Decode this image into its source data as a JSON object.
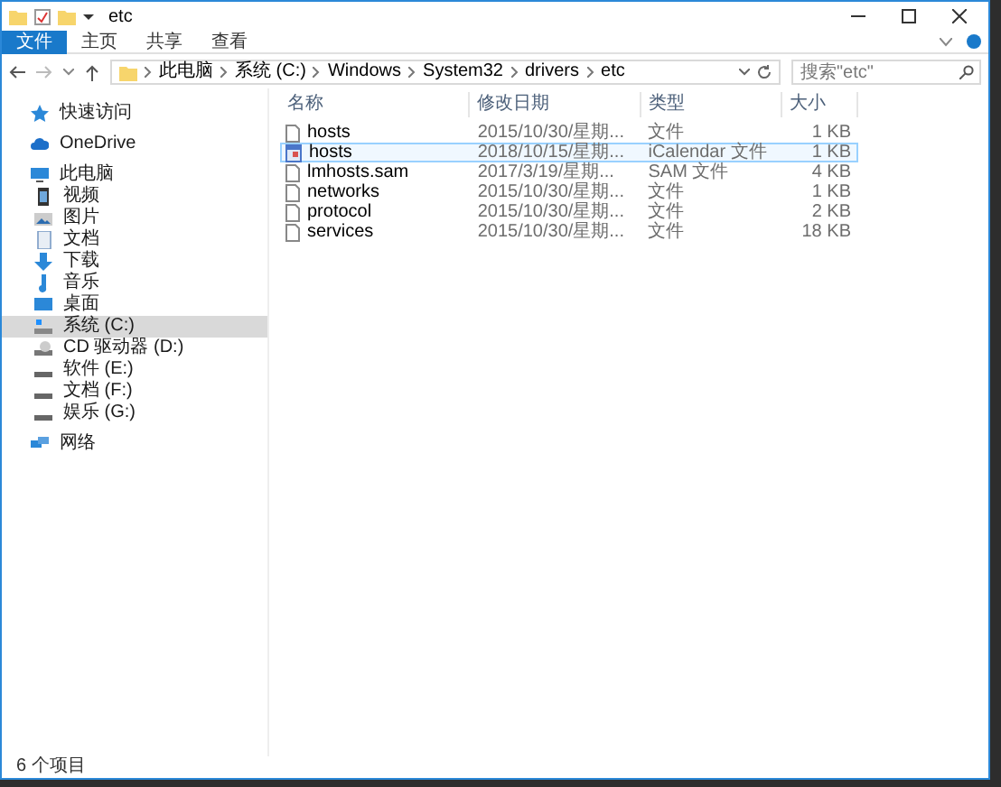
{
  "window": {
    "title": "etc"
  },
  "ribbon_tabs": [
    {
      "label": "文件",
      "selected": true
    },
    {
      "label": "主页",
      "selected": false
    },
    {
      "label": "共享",
      "selected": false
    },
    {
      "label": "查看",
      "selected": false
    }
  ],
  "address_bar": {
    "crumbs": [
      "此电脑",
      "系统 (C:)",
      "Windows",
      "System32",
      "drivers",
      "etc"
    ]
  },
  "search": {
    "placeholder": "搜索\"etc\""
  },
  "sidebar": {
    "items": [
      {
        "label": "快速访问",
        "kind": "star",
        "selected": false
      },
      {
        "label": "OneDrive",
        "kind": "cloud",
        "selected": false
      },
      {
        "label": "此电脑",
        "kind": "pc",
        "selected": false,
        "children": [
          {
            "label": "视频",
            "kind": "video",
            "selected": false
          },
          {
            "label": "图片",
            "kind": "picture",
            "selected": false
          },
          {
            "label": "文档",
            "kind": "doc",
            "selected": false
          },
          {
            "label": "下载",
            "kind": "download",
            "selected": false
          },
          {
            "label": "音乐",
            "kind": "music",
            "selected": false
          },
          {
            "label": "桌面",
            "kind": "desktop",
            "selected": false
          },
          {
            "label": "系统 (C:)",
            "kind": "sysdrive",
            "selected": true
          },
          {
            "label": "CD 驱动器 (D:)",
            "kind": "cd",
            "selected": false
          },
          {
            "label": "软件 (E:)",
            "kind": "drive",
            "selected": false
          },
          {
            "label": "文档 (F:)",
            "kind": "drive",
            "selected": false
          },
          {
            "label": "娱乐 (G:)",
            "kind": "drive",
            "selected": false
          }
        ]
      },
      {
        "label": "网络",
        "kind": "network",
        "selected": false
      }
    ]
  },
  "table": {
    "columns": [
      "名称",
      "修改日期",
      "类型",
      "大小"
    ],
    "rows": [
      {
        "name": "hosts",
        "date": "2015/10/30/星期...",
        "type": "文件",
        "size": "1 KB",
        "kind": "file",
        "selected": false
      },
      {
        "name": "hosts",
        "date": "2018/10/15/星期...",
        "type": "iCalendar 文件",
        "size": "1 KB",
        "kind": "calendar",
        "selected": true
      },
      {
        "name": "lmhosts.sam",
        "date": "2017/3/19/星期...",
        "type": "SAM 文件",
        "size": "4 KB",
        "kind": "file",
        "selected": false
      },
      {
        "name": "networks",
        "date": "2015/10/30/星期...",
        "type": "文件",
        "size": "1 KB",
        "kind": "file",
        "selected": false
      },
      {
        "name": "protocol",
        "date": "2015/10/30/星期...",
        "type": "文件",
        "size": "2 KB",
        "kind": "file",
        "selected": false
      },
      {
        "name": "services",
        "date": "2015/10/30/星期...",
        "type": "文件",
        "size": "18 KB",
        "kind": "file",
        "selected": false
      }
    ]
  },
  "status_bar": {
    "count": "6 个项目"
  }
}
